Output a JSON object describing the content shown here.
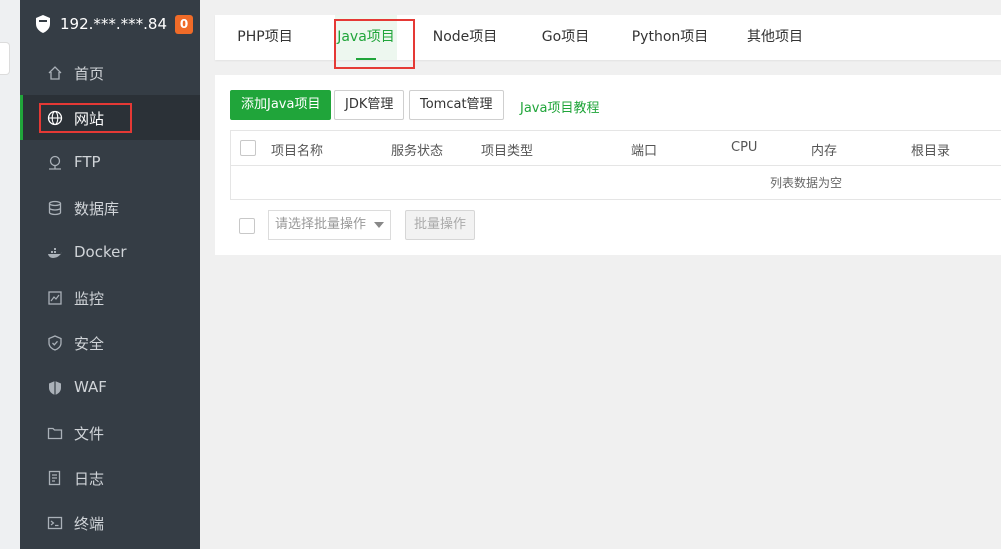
{
  "server": {
    "ip": "192.***.***.84",
    "badge": "0"
  },
  "sidebar": {
    "items": [
      {
        "label": "首页",
        "icon": "home-icon"
      },
      {
        "label": "网站",
        "icon": "globe-icon"
      },
      {
        "label": "FTP",
        "icon": "ftp-icon"
      },
      {
        "label": "数据库",
        "icon": "database-icon"
      },
      {
        "label": "Docker",
        "icon": "docker-icon"
      },
      {
        "label": "监控",
        "icon": "monitor-icon"
      },
      {
        "label": "安全",
        "icon": "shield-icon"
      },
      {
        "label": "WAF",
        "icon": "waf-icon"
      },
      {
        "label": "文件",
        "icon": "folder-icon"
      },
      {
        "label": "日志",
        "icon": "log-icon"
      },
      {
        "label": "终端",
        "icon": "terminal-icon"
      }
    ],
    "active_index": 1
  },
  "tabs": [
    {
      "label": "PHP项目"
    },
    {
      "label": "Java项目"
    },
    {
      "label": "Node项目"
    },
    {
      "label": "Go项目"
    },
    {
      "label": "Python项目"
    },
    {
      "label": "其他项目"
    }
  ],
  "toolbar": {
    "add_label": "添加Java项目",
    "jdk_label": "JDK管理",
    "tomcat_label": "Tomcat管理",
    "tutorial_label": "Java项目教程"
  },
  "table": {
    "columns": [
      "项目名称",
      "服务状态",
      "项目类型",
      "端口",
      "CPU",
      "内存",
      "根目录"
    ],
    "empty_text": "列表数据为空"
  },
  "batch": {
    "placeholder": "请选择批量操作",
    "button_label": "批量操作"
  },
  "colors": {
    "accent": "#20a53a",
    "sidebar": "#353d45",
    "badge": "#f06b28",
    "highlight": "#e53935"
  }
}
